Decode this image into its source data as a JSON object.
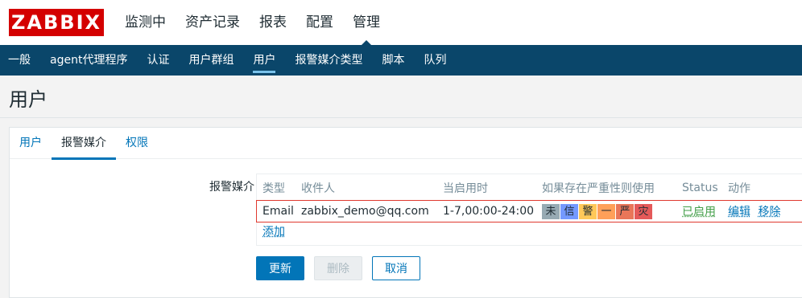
{
  "logo": "ZABBIX",
  "topnav": {
    "items": [
      {
        "label": "监测中"
      },
      {
        "label": "资产记录"
      },
      {
        "label": "报表"
      },
      {
        "label": "配置"
      },
      {
        "label": "管理"
      }
    ],
    "active": "管理"
  },
  "subnav": {
    "items": [
      {
        "label": "一般"
      },
      {
        "label": "agent代理程序"
      },
      {
        "label": "认证"
      },
      {
        "label": "用户群组"
      },
      {
        "label": "用户"
      },
      {
        "label": "报警媒介类型"
      },
      {
        "label": "脚本"
      },
      {
        "label": "队列"
      }
    ],
    "active": "用户"
  },
  "page": {
    "title": "用户"
  },
  "tabs": {
    "items": [
      {
        "label": "用户"
      },
      {
        "label": "报警媒介"
      },
      {
        "label": "权限"
      }
    ],
    "active": "报警媒介"
  },
  "form": {
    "media_label": "报警媒介",
    "columns": [
      "类型",
      "收件人",
      "当启用时",
      "如果存在严重性则使用",
      "Status",
      "动作"
    ],
    "rows": [
      {
        "type": "Email",
        "sendto": "zabbix_demo@qq.com",
        "when_active": "1-7,00:00-24:00",
        "severities": [
          {
            "label": "未",
            "color": "#97aab3"
          },
          {
            "label": "信",
            "color": "#7499ff"
          },
          {
            "label": "警",
            "color": "#ffc859"
          },
          {
            "label": "一",
            "color": "#ffa059"
          },
          {
            "label": "严",
            "color": "#e97659"
          },
          {
            "label": "灾",
            "color": "#e45959"
          }
        ],
        "status": "已启用",
        "actions": {
          "edit": "编辑",
          "remove": "移除"
        }
      }
    ],
    "add_label": "添加"
  },
  "buttons": {
    "update": "更新",
    "delete": "删除",
    "cancel": "取消"
  }
}
